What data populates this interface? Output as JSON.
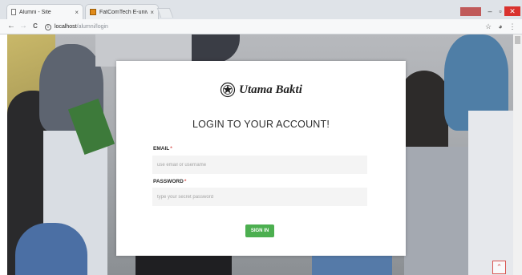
{
  "browser": {
    "tabs": [
      {
        "title": "Alumni - Site",
        "close": "×",
        "favicon": "page-icon",
        "active": true
      },
      {
        "title": "FatComTech E-university",
        "close": "×",
        "favicon": "bookmark-icon",
        "active": false
      }
    ],
    "window_controls": {
      "minimize": "–",
      "maximize": "▫",
      "close": "✕"
    },
    "nav": {
      "back": "←",
      "forward": "→",
      "reload": "C"
    },
    "address": {
      "host": "localhost",
      "path": "/alumni/login",
      "info": "i"
    },
    "toolbar_icons": {
      "star": "☆",
      "extension": "◕",
      "menu": "⋮"
    }
  },
  "login": {
    "brand": "Utama Bakti",
    "title": "LOGIN TO YOUR ACCOUNT!",
    "email_label": "EMAIL",
    "email_placeholder": "use email or username",
    "password_label": "PASSWORD",
    "password_placeholder": "type your secret password",
    "required_mark": "*",
    "signin_label": "SIGN IN"
  },
  "back_to_top": "⌃",
  "colors": {
    "accent_green": "#4caf50",
    "required_red": "#d9534f",
    "close_red": "#d9322e"
  }
}
